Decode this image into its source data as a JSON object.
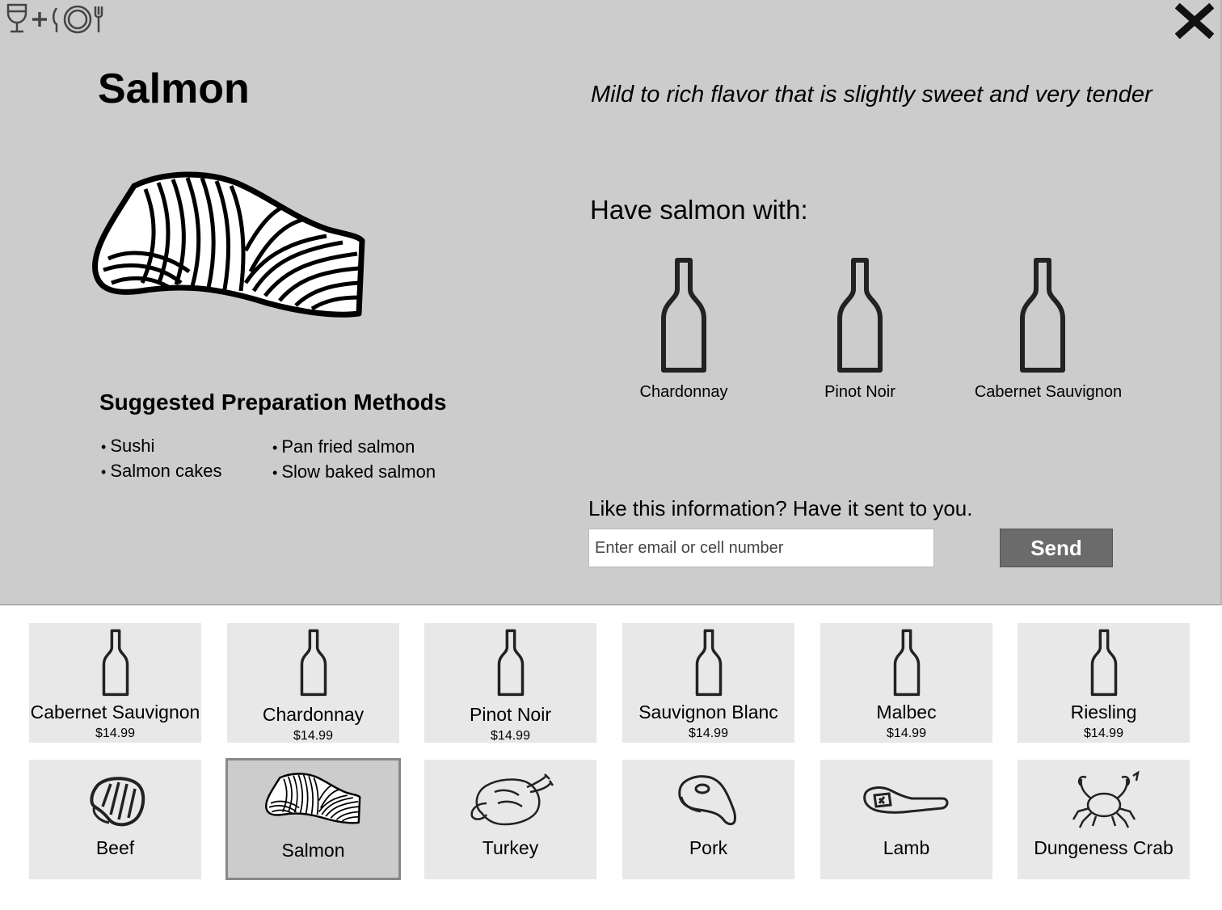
{
  "app": {
    "logo_icon": "wine-plus-plate-icon",
    "close_icon": "close-icon"
  },
  "detail": {
    "title": "Salmon",
    "image_icon": "salmon-fillet-icon",
    "tagline": "Mild to rich flavor that is slightly sweet and very tender",
    "pairing_heading": "Have salmon with:",
    "pairings": [
      {
        "label": "Chardonnay",
        "icon": "wine-bottle-icon"
      },
      {
        "label": "Pinot Noir",
        "icon": "wine-bottle-icon"
      },
      {
        "label": "Cabernet Sauvignon",
        "icon": "wine-bottle-icon"
      }
    ],
    "prep_heading": "Suggested Preparation Methods",
    "prep_methods": [
      "Sushi",
      "Salmon cakes",
      "Pan fried salmon",
      "Slow baked salmon"
    ]
  },
  "send": {
    "prompt": "Like this information? Have it sent to you.",
    "placeholder": "Enter email or cell number",
    "value": "",
    "button_label": "Send"
  },
  "wines": [
    {
      "name": "Cabernet Sauvignon",
      "price": "$14.99",
      "icon": "wine-bottle-icon"
    },
    {
      "name": "Chardonnay",
      "price": "$14.99",
      "icon": "wine-bottle-icon"
    },
    {
      "name": "Pinot Noir",
      "price": "$14.99",
      "icon": "wine-bottle-icon"
    },
    {
      "name": "Sauvignon Blanc",
      "price": "$14.99",
      "icon": "wine-bottle-icon"
    },
    {
      "name": "Malbec",
      "price": "$14.99",
      "icon": "wine-bottle-icon"
    },
    {
      "name": "Riesling",
      "price": "$14.99",
      "icon": "wine-bottle-icon"
    }
  ],
  "foods": [
    {
      "name": "Beef",
      "icon": "steak-icon",
      "selected": false
    },
    {
      "name": "Salmon",
      "icon": "salmon-fillet-icon",
      "selected": true
    },
    {
      "name": "Turkey",
      "icon": "roast-turkey-icon",
      "selected": false
    },
    {
      "name": "Pork",
      "icon": "pork-chop-icon",
      "selected": false
    },
    {
      "name": "Lamb",
      "icon": "lamb-chop-icon",
      "selected": false
    },
    {
      "name": "Dungeness Crab",
      "icon": "crab-icon",
      "selected": false
    }
  ]
}
